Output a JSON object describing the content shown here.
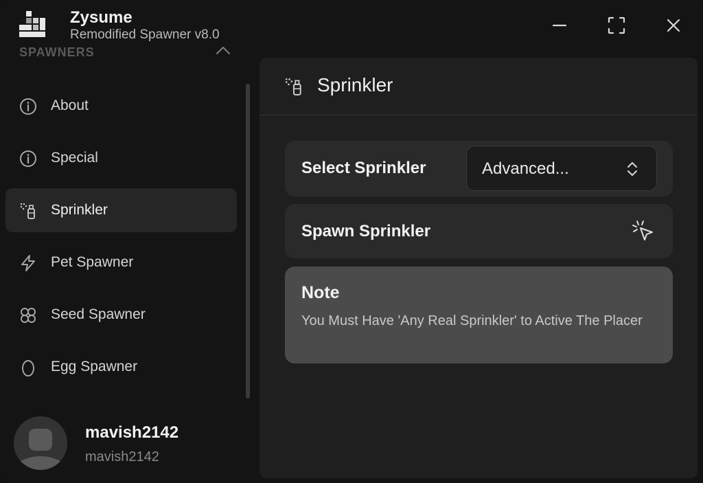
{
  "app": {
    "title": "Zysume",
    "subtitle": "Remodified Spawner v8.0"
  },
  "window_controls": {
    "minimize_icon": "minus-icon",
    "maximize_icon": "fullscreen-icon",
    "close_icon": "close-icon"
  },
  "sidebar": {
    "section_label": "SPAWNERS",
    "items": [
      {
        "label": "About",
        "icon": "info-icon",
        "active": false
      },
      {
        "label": "Special",
        "icon": "info-icon",
        "active": false
      },
      {
        "label": "Sprinkler",
        "icon": "spray-bottle-icon",
        "active": true
      },
      {
        "label": "Pet Spawner",
        "icon": "lightning-icon",
        "active": false
      },
      {
        "label": "Seed Spawner",
        "icon": "flower-icon",
        "active": false
      },
      {
        "label": "Egg Spawner",
        "icon": "egg-icon",
        "active": false
      }
    ]
  },
  "user": {
    "name": "mavish2142",
    "handle": "mavish2142"
  },
  "main": {
    "title": "Sprinkler",
    "title_icon": "spray-bottle-icon",
    "select": {
      "label": "Select Sprinkler",
      "value": "Advanced..."
    },
    "spawn": {
      "label": "Spawn Sprinkler",
      "icon": "click-pointer-icon"
    },
    "note": {
      "title": "Note",
      "text": "You Must Have 'Any Real Sprinkler' to Active The Placer"
    }
  },
  "colors": {
    "background": "#141414",
    "panel": "#1f1f1f",
    "card": "#2a2a2a",
    "note_card": "#4b4b4b",
    "active_item": "#262626",
    "text_primary": "#f2f2f2",
    "text_secondary": "#8a8a8a"
  }
}
